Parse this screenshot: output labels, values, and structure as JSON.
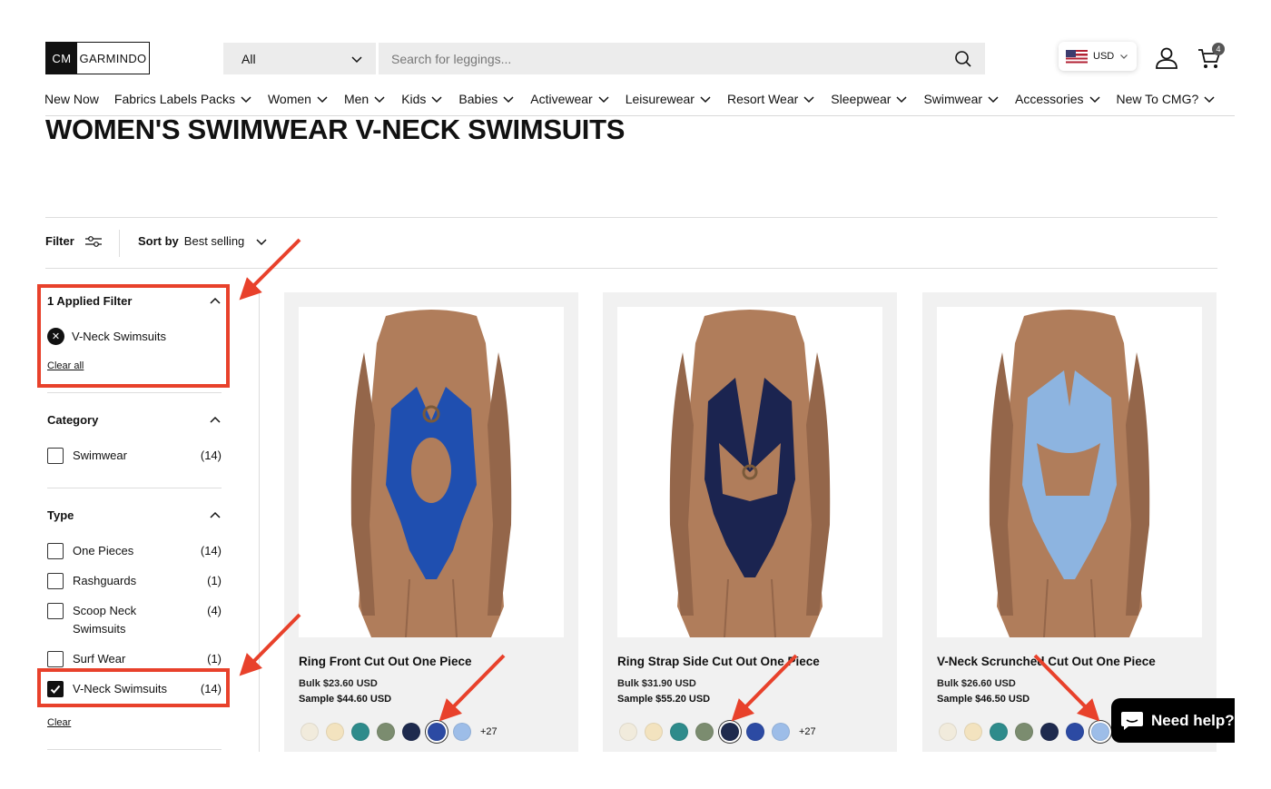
{
  "header": {
    "logo_cm": "CM",
    "logo_name": "GARMINDO",
    "category_select": "All",
    "search_placeholder": "Search for leggings...",
    "currency": "USD",
    "cart_count": "4"
  },
  "nav": [
    {
      "label": "New Now",
      "dropdown": false
    },
    {
      "label": "Fabrics Labels Packs",
      "dropdown": true
    },
    {
      "label": "Women",
      "dropdown": true
    },
    {
      "label": "Men",
      "dropdown": true
    },
    {
      "label": "Kids",
      "dropdown": true
    },
    {
      "label": "Babies",
      "dropdown": true
    },
    {
      "label": "Activewear",
      "dropdown": true
    },
    {
      "label": "Leisurewear",
      "dropdown": true
    },
    {
      "label": "Resort Wear",
      "dropdown": true
    },
    {
      "label": "Sleepwear",
      "dropdown": true
    },
    {
      "label": "Swimwear",
      "dropdown": true
    },
    {
      "label": "Accessories",
      "dropdown": true
    },
    {
      "label": "New To CMG?",
      "dropdown": true
    }
  ],
  "page_title": "WOMEN'S SWIMWEAR V-NECK SWIMSUITS",
  "toolbar": {
    "filter_label": "Filter",
    "sort_label": "Sort by",
    "sort_value": "Best selling"
  },
  "sidebar": {
    "applied": {
      "heading": "1 Applied Filter",
      "chip": "V-Neck Swimsuits",
      "clear_all": "Clear all"
    },
    "category": {
      "heading": "Category",
      "options": [
        {
          "label": "Swimwear",
          "count": "(14)",
          "checked": false
        }
      ]
    },
    "type": {
      "heading": "Type",
      "options": [
        {
          "label": "One Pieces",
          "count": "(14)",
          "checked": false
        },
        {
          "label": "Rashguards",
          "count": "(1)",
          "checked": false
        },
        {
          "label": "Scoop Neck Swimsuits",
          "count": "(4)",
          "checked": false
        },
        {
          "label": "Surf Wear",
          "count": "(1)",
          "checked": false
        },
        {
          "label": "V-Neck Swimsuits",
          "count": "(14)",
          "checked": true
        }
      ],
      "clear": "Clear"
    }
  },
  "swatch_colors": [
    "#f1ebdc",
    "#f3e3bf",
    "#2e8b8b",
    "#7b8c6f",
    "#1e2a4e",
    "#2c4aa3",
    "#9dbde8"
  ],
  "products": [
    {
      "title": "Ring Front Cut Out One Piece",
      "bulk": "Bulk $23.60 USD",
      "sample": "Sample $44.60 USD",
      "more": "+27",
      "selected_swatch": 5,
      "suit_color": "#1f4fb0"
    },
    {
      "title": "Ring Strap Side Cut Out One Piece",
      "bulk": "Bulk $31.90 USD",
      "sample": "Sample $55.20 USD",
      "more": "+27",
      "selected_swatch": 4,
      "suit_color": "#1b2450"
    },
    {
      "title": "V-Neck Scrunched Cut Out One Piece",
      "bulk": "Bulk $26.60 USD",
      "sample": "Sample $46.50 USD",
      "more": "",
      "selected_swatch": 6,
      "suit_color": "#8db4e0"
    }
  ],
  "chat": {
    "label": "Need help?"
  },
  "annotation_color": "#e8412b"
}
